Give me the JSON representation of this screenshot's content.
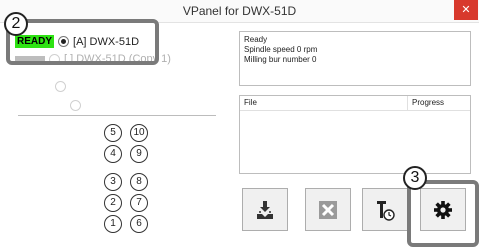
{
  "window": {
    "title": "VPanel for DWX-51D",
    "close_glyph": "✕"
  },
  "machines": [
    {
      "status_badge": "READY",
      "label": "[A] DWX-51D",
      "selected": true
    },
    {
      "label": "[ ] DWX-51D (Copy 1)",
      "selected": false
    }
  ],
  "callouts": [
    "2",
    "3"
  ],
  "tool_slots": [
    "5",
    "10",
    "4",
    "9",
    "3",
    "8",
    "2",
    "7",
    "1",
    "6"
  ],
  "status": {
    "line1": "Ready",
    "line2": "Spindle speed 0 rpm",
    "line3": "Milling bur number 0"
  },
  "file_list": {
    "col_file": "File",
    "col_progress": "Progress"
  },
  "toolbar": {
    "buttons": [
      {
        "icon": "output-icon",
        "enabled": true
      },
      {
        "icon": "cancel-icon",
        "enabled": false
      },
      {
        "icon": "tool-timer-icon",
        "enabled": true
      },
      {
        "icon": "gear-icon",
        "enabled": true
      }
    ]
  }
}
